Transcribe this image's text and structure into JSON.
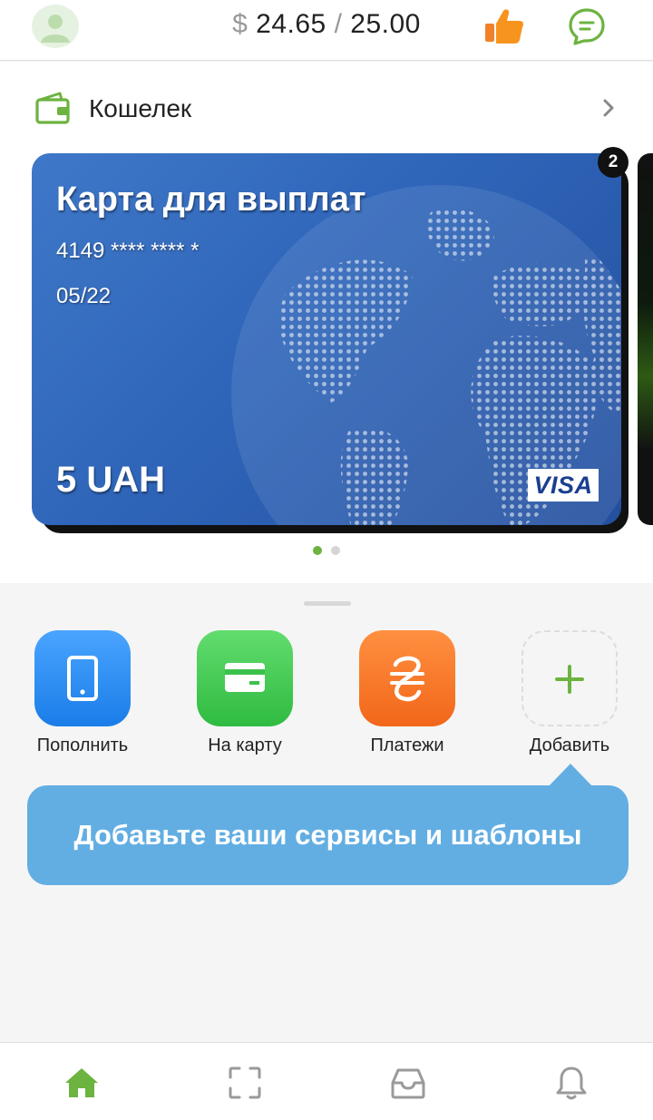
{
  "header": {
    "currency_symbol": "$",
    "balance": "24.65",
    "separator": "/",
    "limit": "25.00",
    "avatar_icon": "user-avatar-icon",
    "like_icon": "thumbs-up-icon",
    "chat_icon": "chat-icon"
  },
  "wallet": {
    "title": "Кошелек",
    "icon": "wallet-icon",
    "chevron_icon": "chevron-right-icon"
  },
  "card": {
    "title": "Карта для выплат",
    "number": "4149 **** **** *",
    "expiry": "05/22",
    "amount": "5 UAH",
    "brand": "VISA",
    "badge_count": "2"
  },
  "pagination": {
    "total": 2,
    "active_index": 0
  },
  "actions": [
    {
      "label": "Пополнить",
      "icon": "phone-icon"
    },
    {
      "label": "На карту",
      "icon": "card-icon"
    },
    {
      "label": "Платежи",
      "icon": "hryvnia-icon"
    },
    {
      "label": "Добавить",
      "icon": "plus-icon"
    }
  ],
  "tooltip": {
    "text": "Добавьте ваши сервисы и шаблоны"
  },
  "bottom_nav": [
    {
      "icon": "home-icon",
      "active": true
    },
    {
      "icon": "scan-icon",
      "active": false
    },
    {
      "icon": "inbox-icon",
      "active": false
    },
    {
      "icon": "bell-icon",
      "active": false
    }
  ],
  "colors": {
    "accent_green": "#6cb33f",
    "tooltip_blue": "#62aee3",
    "card_blue": "#2f65b9",
    "inactive_icon": "#9a9a9a"
  }
}
